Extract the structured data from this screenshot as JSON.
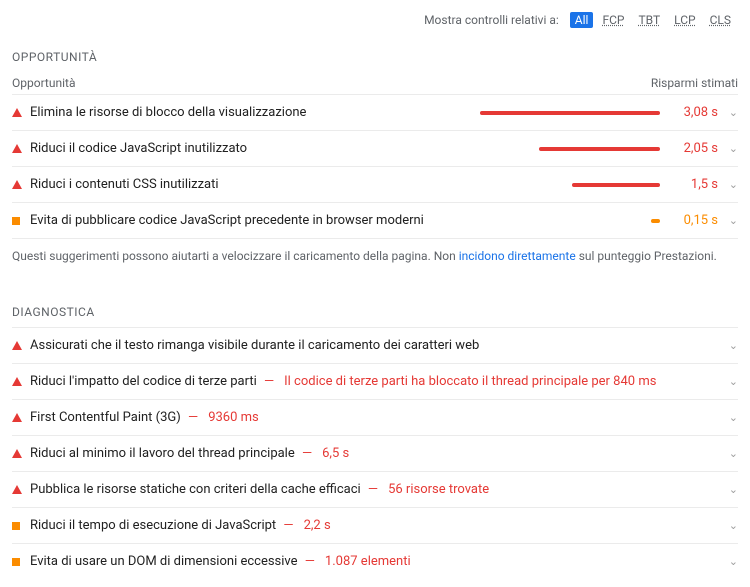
{
  "filter": {
    "label": "Mostra controlli relativi a:",
    "options": [
      "All",
      "FCP",
      "TBT",
      "LCP",
      "CLS"
    ],
    "active": "All"
  },
  "opportunita": {
    "title": "OPPORTUNITÀ",
    "col_left": "Opportunità",
    "col_right": "Risparmi stimati",
    "rows": [
      {
        "severity": "red",
        "label": "Elimina le risorse di blocco della visualizzazione",
        "bar_pct": 100,
        "time": "3,08 s"
      },
      {
        "severity": "red",
        "label": "Riduci il codice JavaScript inutilizzato",
        "bar_pct": 67,
        "time": "2,05 s"
      },
      {
        "severity": "red",
        "label": "Riduci i contenuti CSS inutilizzati",
        "bar_pct": 49,
        "time": "1,5 s"
      },
      {
        "severity": "orange",
        "label": "Evita di pubblicare codice JavaScript precedente in browser moderni",
        "bar_pct": 5,
        "time": "0,15 s"
      }
    ],
    "footnote_pre": "Questi suggerimenti possono aiutarti a velocizzare il caricamento della pagina. Non ",
    "footnote_link": "incidono direttamente",
    "footnote_post": " sul punteggio Prestazioni."
  },
  "diagnostica": {
    "title": "DIAGNOSTICA",
    "rows": [
      {
        "severity": "red",
        "label": "Assicurati che il testo rimanga visibile durante il caricamento dei caratteri web",
        "detail": ""
      },
      {
        "severity": "red",
        "label": "Riduci l'impatto del codice di terze parti",
        "detail": "Il codice di terze parti ha bloccato il thread principale per 840 ms"
      },
      {
        "severity": "red",
        "label": "First Contentful Paint (3G)",
        "detail": "9360 ms"
      },
      {
        "severity": "red",
        "label": "Riduci al minimo il lavoro del thread principale",
        "detail": "6,5 s"
      },
      {
        "severity": "red",
        "label": "Pubblica le risorse statiche con criteri della cache efficaci",
        "detail": "56 risorse trovate"
      },
      {
        "severity": "orange",
        "label": "Riduci il tempo di esecuzione di JavaScript",
        "detail": "2,2 s"
      },
      {
        "severity": "orange",
        "label": "Evita di usare un DOM di dimensioni eccessive",
        "detail": "1.087 elementi"
      }
    ]
  }
}
